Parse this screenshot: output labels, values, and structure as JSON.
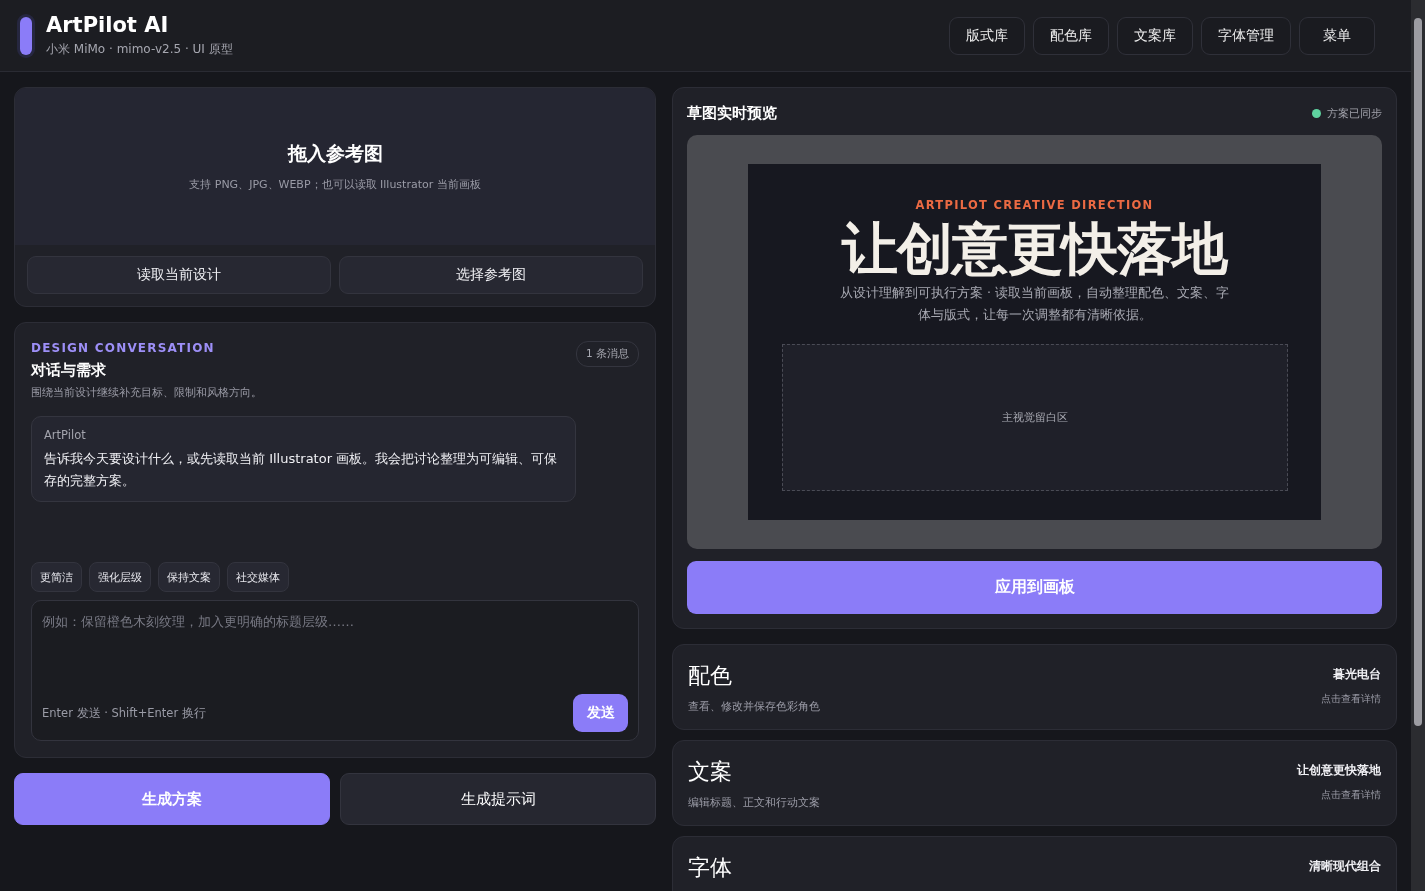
{
  "header": {
    "title": "ArtPilot AI",
    "subtitle": "小米 MiMo · mimo-v2.5 · UI 原型",
    "nav": [
      "版式库",
      "配色库",
      "文案库",
      "字体管理",
      "菜单"
    ]
  },
  "upload": {
    "title": "拖入参考图",
    "hint": "支持 PNG、JPG、WEBP；也可以读取 Illustrator 当前画板",
    "buttons": [
      "读取当前设计",
      "选择参考图"
    ]
  },
  "conversation": {
    "eyebrow": "DESIGN CONVERSATION",
    "title": "对话与需求",
    "description": "围绕当前设计继续补充目标、限制和风格方向。",
    "badge": "1 条消息",
    "messages": [
      {
        "author": "ArtPilot",
        "text": "告诉我今天要设计什么，或先读取当前 Illustrator 画板。我会把讨论整理为可编辑、可保存的完整方案。"
      }
    ],
    "chips": [
      "更简洁",
      "强化层级",
      "保持文案",
      "社交媒体"
    ],
    "input": {
      "placeholder": "例如：保留橙色木刻纹理，加入更明确的标题层级……",
      "hint": "Enter 发送 · Shift+Enter 换行",
      "send": "发送"
    }
  },
  "actions": [
    {
      "label": "生成方案",
      "kind": "primary"
    },
    {
      "label": "生成提示词",
      "kind": "secondary"
    }
  ],
  "preview": {
    "title": "草图实时预览",
    "status": "方案已同步",
    "canvas": {
      "eyebrow": "ARTPILOT CREATIVE DIRECTION",
      "headline": "让创意更快落地",
      "body": "从设计理解到可执行方案 · 读取当前画板，自动整理配色、文案、字体与版式，让每一次调整都有清晰依据。",
      "placeholder": "主视觉留白区"
    },
    "apply": "应用到画板"
  },
  "sections": [
    {
      "title": "配色",
      "description": "查看、修改并保存色彩角色",
      "value": "暮光电台",
      "link": "点击查看详情"
    },
    {
      "title": "文案",
      "description": "编辑标题、正文和行动文案",
      "value": "让创意更快落地",
      "link": "点击查看详情"
    },
    {
      "title": "字体",
      "value": "清晰现代组合"
    }
  ]
}
